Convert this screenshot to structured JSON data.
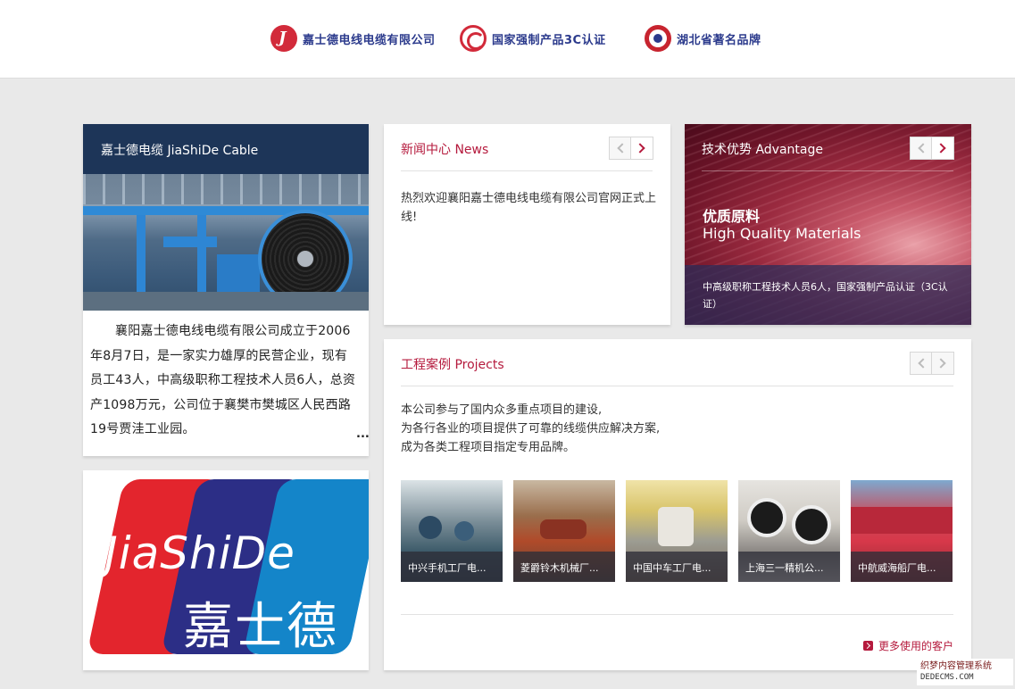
{
  "header": {
    "items": [
      {
        "label": "嘉士德电线电缆有限公司",
        "icon": "jiashide-logo-icon"
      },
      {
        "label": "国家强制产品3C认证",
        "icon": "ccc-certification-icon"
      },
      {
        "label": "湖北省著名品牌",
        "icon": "hubei-brand-icon"
      }
    ]
  },
  "intro": {
    "title": "嘉士德电缆 JiaShiDe Cable",
    "text": "襄阳嘉士德电线电缆有限公司成立于2006年8月7日，是一家实力雄厚的民营企业，现有员工43人，中高级职称工程技术人员6人，总资产1098万元，公司位于襄樊市樊城区人民西路19号贾洼工业园。",
    "more": "..."
  },
  "logo_card": {
    "latin": "JiaShiDe",
    "chinese": "嘉士德"
  },
  "news": {
    "title": "新闻中心 News",
    "text": "热烈欢迎襄阳嘉士德电线电缆有限公司官网正式上线!"
  },
  "advantage": {
    "title": "技术优势 Advantage",
    "headline": "优质原料",
    "subheadline": "High Quality Materials",
    "caption": "中高级职称工程技术人员6人，国家强制产品认证（3C认证）"
  },
  "projects": {
    "title": "工程案例 Projects",
    "description": [
      "本公司参与了国内众多重点项目的建设,",
      "为各行各业的项目提供了可靠的线缆供应解决方案,",
      "成为各类工程项目指定专用品牌。"
    ],
    "cases": [
      {
        "caption": "中兴手机工厂电..."
      },
      {
        "caption": "菱爵铃木机械厂..."
      },
      {
        "caption": "中国中车工厂电..."
      },
      {
        "caption": "上海三一精机公..."
      },
      {
        "caption": "中航威海船厂电..."
      }
    ],
    "more": "更多使用的客户"
  },
  "watermark": {
    "line1": "织梦内容管理系统",
    "line2": "DEDECMS.COM"
  }
}
